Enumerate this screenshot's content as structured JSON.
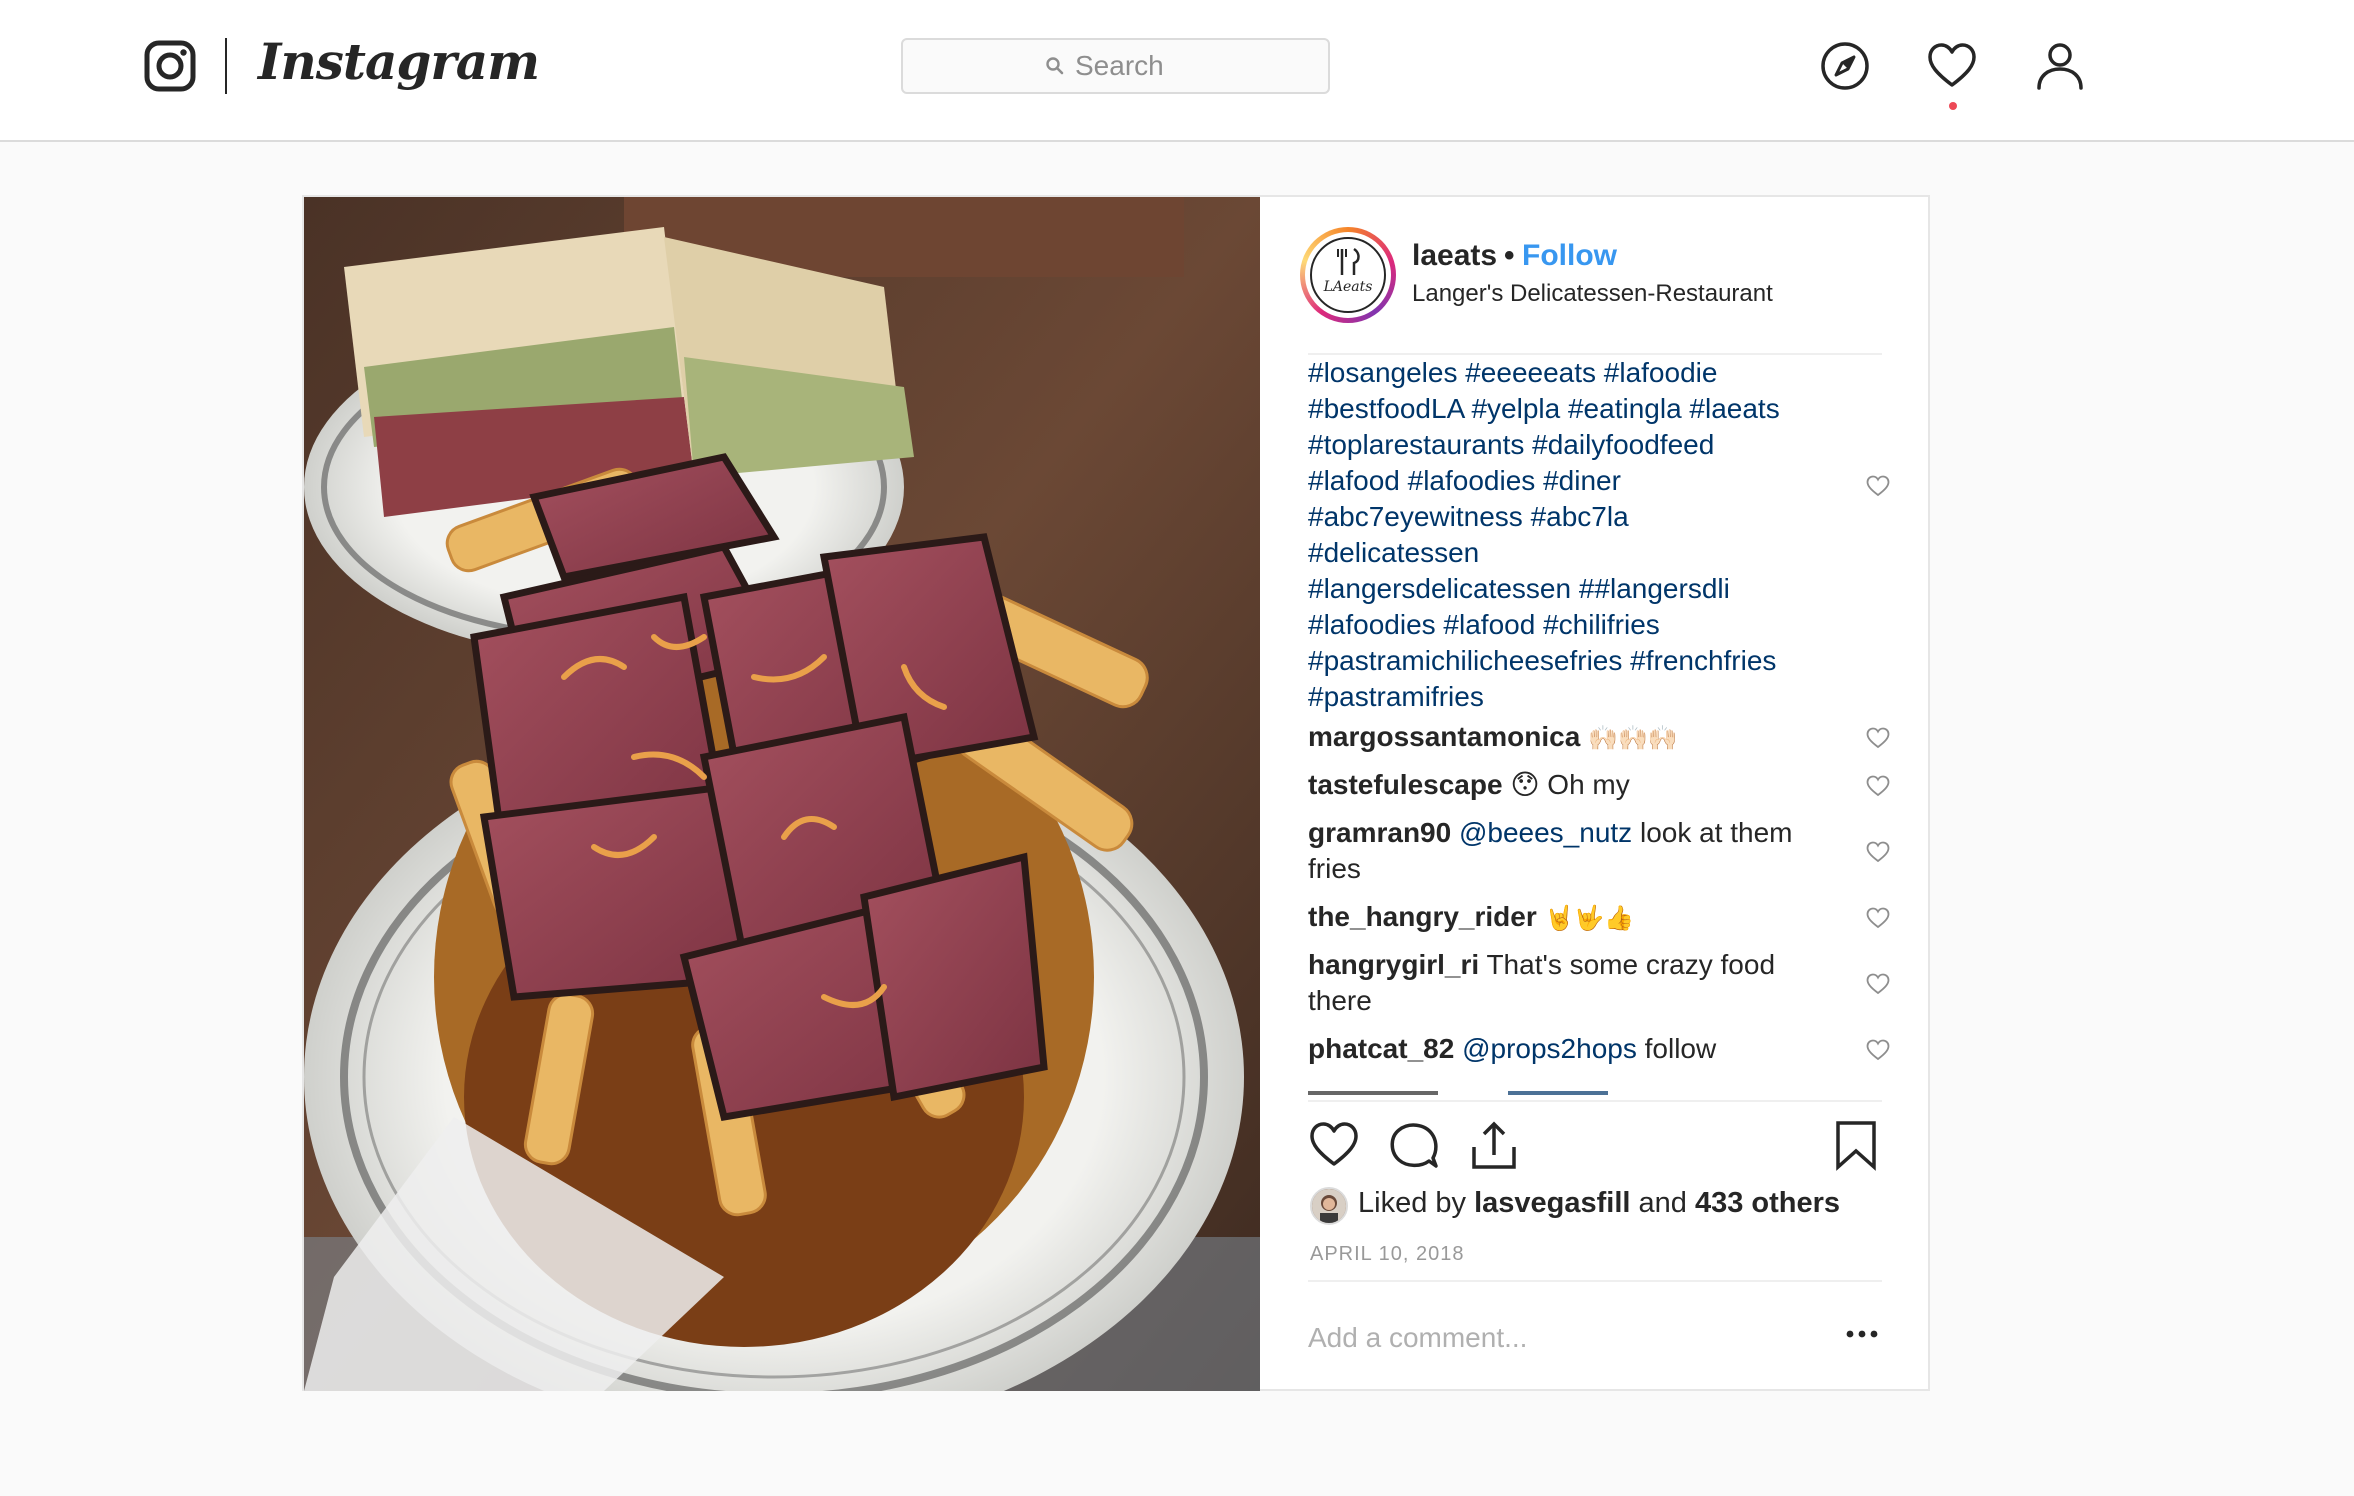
{
  "topbar": {
    "wordmark": "Instagram",
    "search_placeholder": "Search",
    "icons": [
      "instagram-glyph-icon",
      "search-icon",
      "compass-icon",
      "heart-icon",
      "profile-icon"
    ],
    "notification_color": "#ed4956"
  },
  "post": {
    "photo": "plate of pastrami chili cheese fries with a pastrami sandwich in background",
    "header": {
      "avatar_text": "LAeats",
      "username": "laeats",
      "separator": "•",
      "follow_label": "Follow",
      "location": "Langer's Delicatessen-Restaurant"
    },
    "caption_lines": [
      "#losangeles #eeeeeats #lafoodie",
      "#bestfoodLA #yelpla #eatingla #laeats",
      "#toplarestaurants #dailyfoodfeed",
      "#lafood #lafoodies #diner",
      "#abc7eyewitness #abc7la",
      "#delicatessen",
      "#langersdelicatessen ##langersdli",
      "#lafoodies #lafood #chilifries",
      "#pastramichilicheesefries #frenchfries",
      "#pastramifries"
    ],
    "comments": [
      {
        "user": "margossantamonica",
        "pre": "",
        "mention": "",
        "text": "🙌🏻🙌🏻🙌🏻"
      },
      {
        "user": "tastefulescape",
        "pre": "",
        "mention": "",
        "text": "😯 Oh my"
      },
      {
        "user": "gramran90",
        "pre": "",
        "mention": "@beees_nutz",
        "text": " look at them",
        "text2": "fries"
      },
      {
        "user": "the_hangry_rider",
        "pre": "",
        "mention": "",
        "text": "🤘🤟👍"
      },
      {
        "user": "hangrygirl_ri",
        "pre": "",
        "mention": "",
        "text": " That's some crazy food",
        "text2": "there"
      },
      {
        "user": "phatcat_82",
        "pre": "",
        "mention": "@props2hops",
        "text": " follow"
      }
    ],
    "likes": {
      "prefix": "Liked by ",
      "user": "lasvegasfill",
      "middle": " and ",
      "others": "433 others"
    },
    "date": "APRIL 10, 2018",
    "add_comment_placeholder": "Add a comment...",
    "colors": {
      "link": "#3897f0",
      "hashtag": "#003569",
      "text": "#262626",
      "muted": "#999999"
    }
  }
}
